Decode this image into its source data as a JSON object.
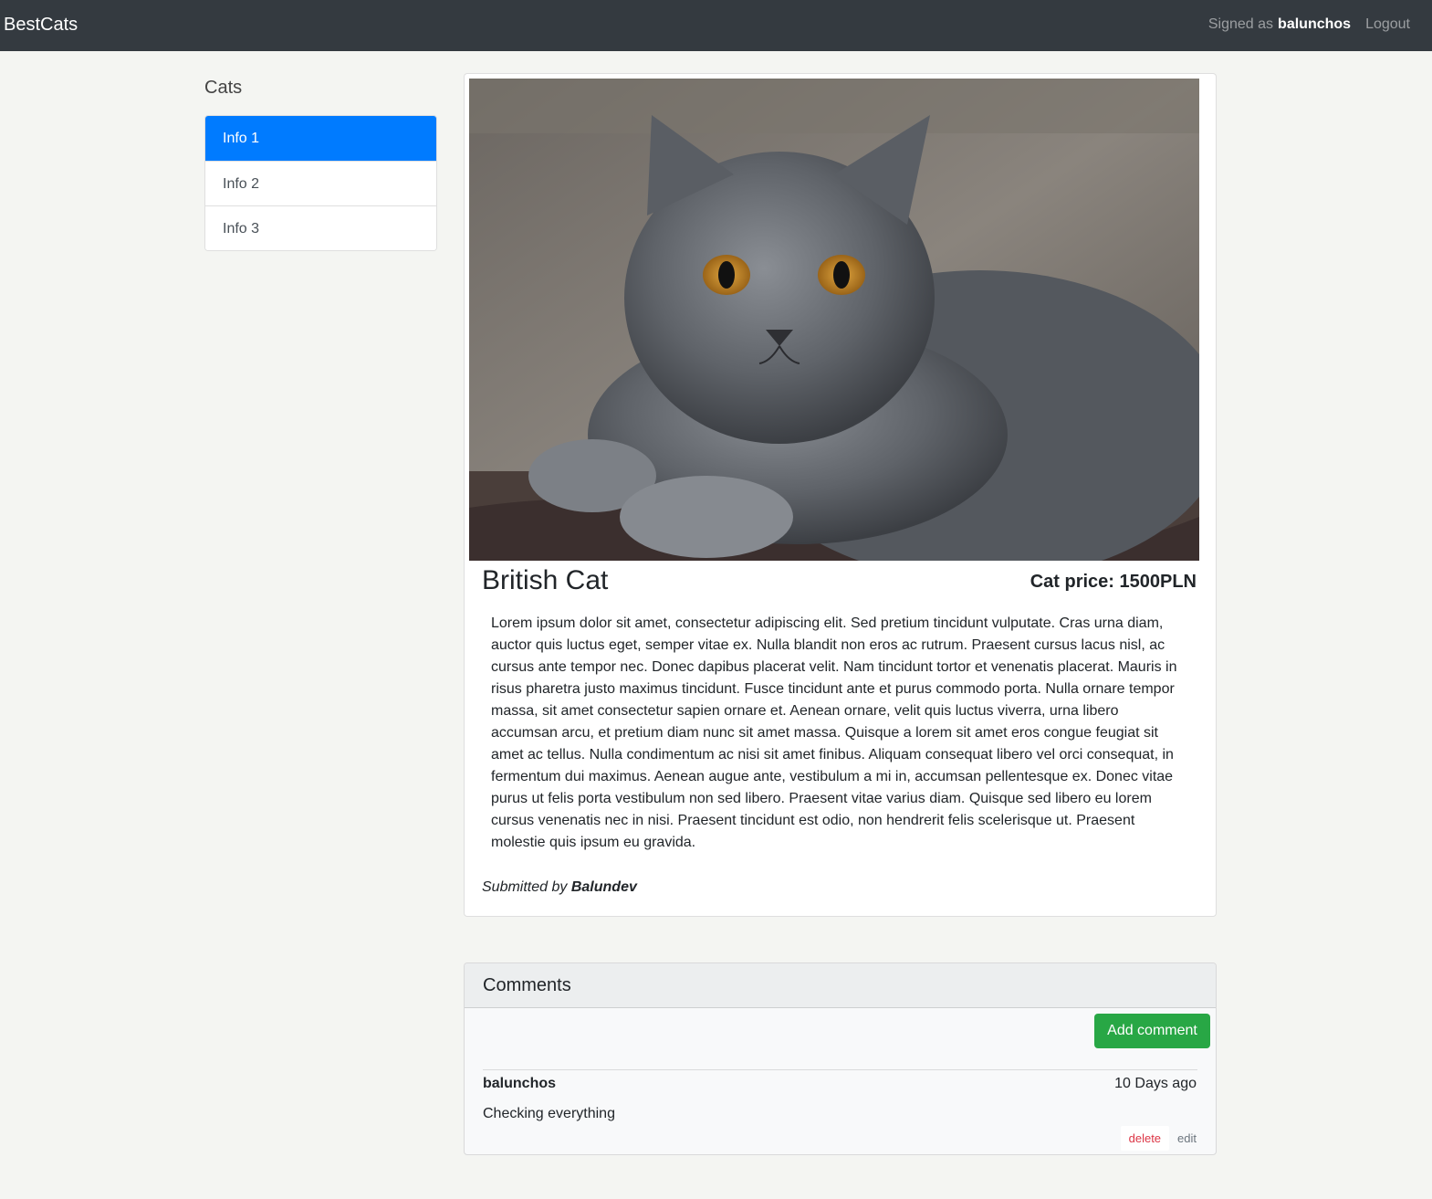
{
  "navbar": {
    "brand": "BestCats",
    "signed_prefix": "Signed as",
    "username": "balunchos",
    "logout_label": "Logout"
  },
  "sidebar": {
    "title": "Cats",
    "items": [
      {
        "label": "Info 1",
        "active": true
      },
      {
        "label": "Info 2",
        "active": false
      },
      {
        "label": "Info 3",
        "active": false
      }
    ]
  },
  "cat": {
    "name": "British Cat",
    "price_label": "Cat price: 1500PLN",
    "description": "Lorem ipsum dolor sit amet, consectetur adipiscing elit. Sed pretium tincidunt vulputate. Cras urna diam, auctor quis luctus eget, semper vitae ex. Nulla blandit non eros ac rutrum. Praesent cursus lacus nisl, ac cursus ante tempor nec. Donec dapibus placerat velit. Nam tincidunt tortor et venenatis placerat. Mauris in risus pharetra justo maximus tincidunt. Fusce tincidunt ante et purus commodo porta. Nulla ornare tempor massa, sit amet consectetur sapien ornare et. Aenean ornare, velit quis luctus viverra, urna libero accumsan arcu, et pretium diam nunc sit amet massa. Quisque a lorem sit amet eros congue feugiat sit amet ac tellus. Nulla condimentum ac nisi sit amet finibus. Aliquam consequat libero vel orci consequat, in fermentum dui maximus. Aenean augue ante, vestibulum a mi in, accumsan pellentesque ex. Donec vitae purus ut felis porta vestibulum non sed libero. Praesent vitae varius diam. Quisque sed libero eu lorem cursus venenatis nec in nisi. Praesent tincidunt est odio, non hendrerit felis scelerisque ut. Praesent molestie quis ipsum eu gravida.",
    "submitted_prefix": "Submitted by",
    "submitted_by": "Balundev"
  },
  "comments": {
    "title": "Comments",
    "add_label": "Add comment",
    "items": [
      {
        "author": "balunchos",
        "time": "10 Days ago",
        "text": "Checking everything",
        "delete_label": "delete",
        "edit_label": "edit"
      }
    ]
  },
  "colors": {
    "navbar": "#343a40",
    "active_item": "#007bff",
    "add_button": "#28a745",
    "delete_link": "#dc3545"
  }
}
